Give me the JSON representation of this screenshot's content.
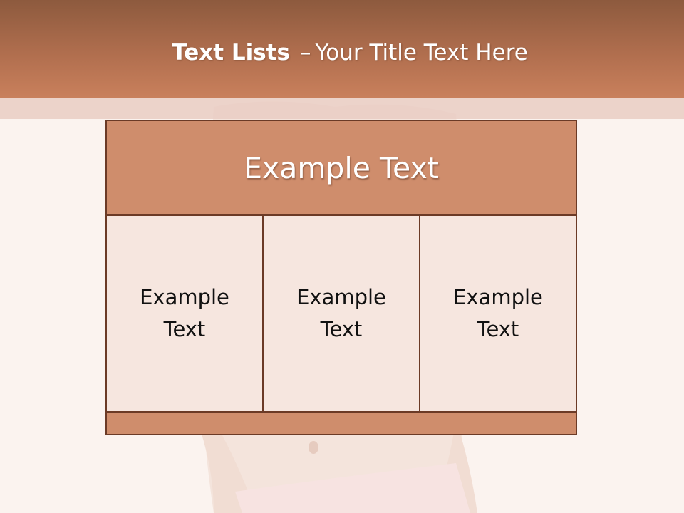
{
  "title": {
    "bold": "Text Lists",
    "dash": "–",
    "rest": "Your Title Text Here"
  },
  "table": {
    "header": "Example Text",
    "cells": [
      {
        "line1": "Example",
        "line2": "Text"
      },
      {
        "line1": "Example",
        "line2": "Text"
      },
      {
        "line1": "Example",
        "line2": "Text"
      }
    ]
  },
  "colors": {
    "header_band": "#b06e4e",
    "table_header": "#cf8d6c",
    "cell_fill": "#f6e6df",
    "border": "#6b3a26"
  }
}
